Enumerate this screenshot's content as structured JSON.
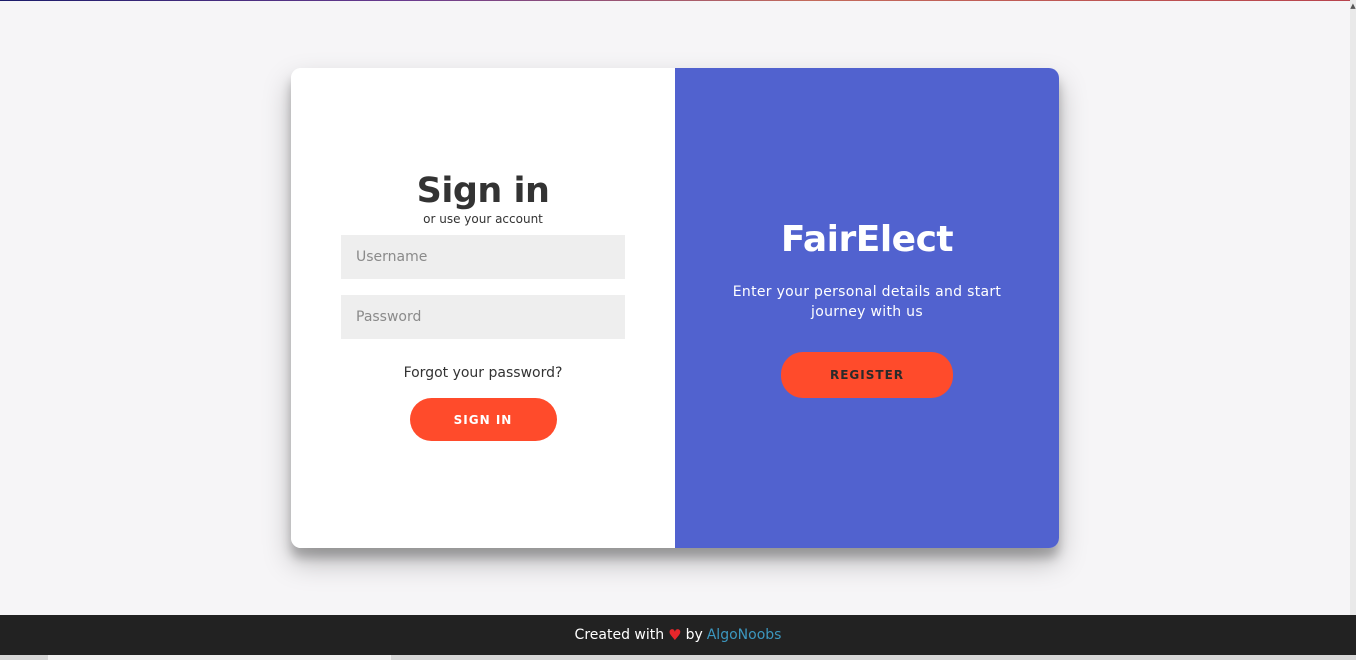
{
  "signin": {
    "title": "Sign in",
    "subtitle": "or use your account",
    "username_placeholder": "Username",
    "password_placeholder": "Password",
    "forgot_label": "Forgot your password?",
    "button_label": "Sign In"
  },
  "overlay": {
    "title": "FairElect",
    "text": "Enter your personal details and start journey with us",
    "register_label": "Register"
  },
  "footer": {
    "prefix": "Created with",
    "by": "by",
    "author": "AlgoNoobs"
  },
  "colors": {
    "accent": "#ff4b2b",
    "overlay_bg": "#5162cf",
    "footer_bg": "#222222",
    "link": "#3c97bf",
    "heart": "#e8262b"
  },
  "icons": {
    "heart": "heart-icon"
  }
}
